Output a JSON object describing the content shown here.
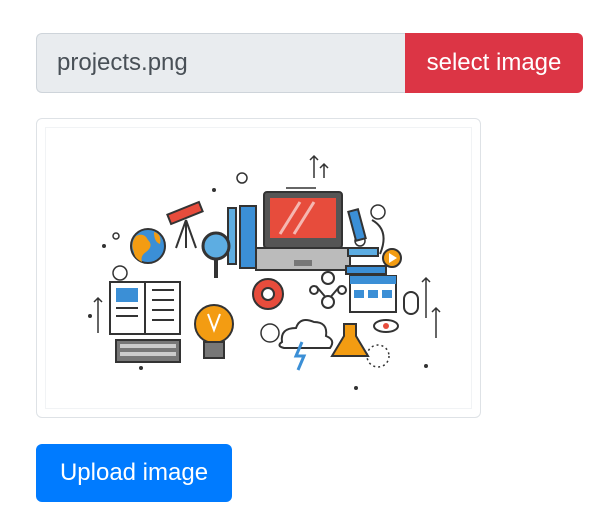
{
  "file_input": {
    "filename": "projects.png",
    "select_label": "select image"
  },
  "preview": {
    "alt": "projects illustration",
    "icon": "science-education-illustration"
  },
  "actions": {
    "upload_label": "Upload image"
  },
  "colors": {
    "select_button": "#dc3545",
    "upload_button": "#007bff",
    "file_bg": "#e9ecef"
  }
}
